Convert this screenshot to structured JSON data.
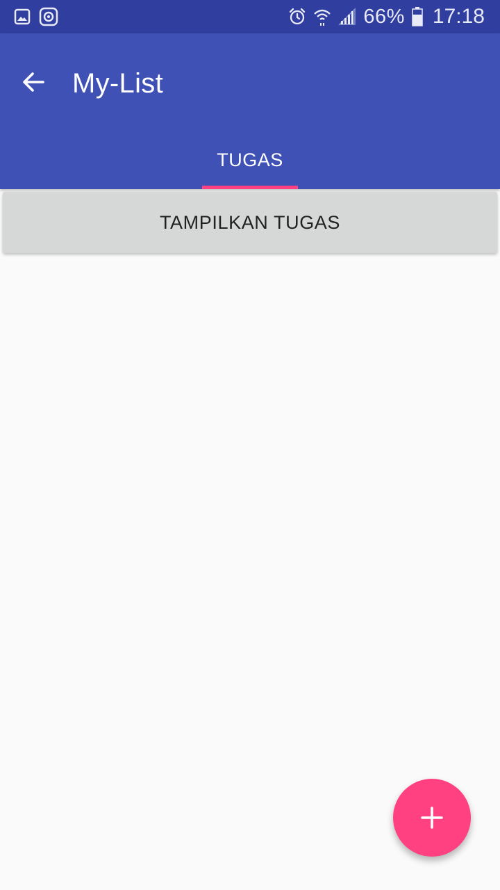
{
  "status_bar": {
    "icons_left": [
      "image-icon",
      "record-icon"
    ],
    "icons_right": [
      "alarm-icon",
      "wifi-icon",
      "signal-icon",
      "battery-icon"
    ],
    "battery_percent": "66%",
    "time": "17:18"
  },
  "app_bar": {
    "title": "My-List",
    "back_icon": "arrow-left-icon",
    "color": "#3f51b5"
  },
  "tabs": [
    {
      "label": "TUGAS",
      "selected": true
    }
  ],
  "main": {
    "show_button_label": "TAMPILKAN TUGAS"
  },
  "fab": {
    "icon": "plus-icon",
    "color": "#ff4081"
  }
}
